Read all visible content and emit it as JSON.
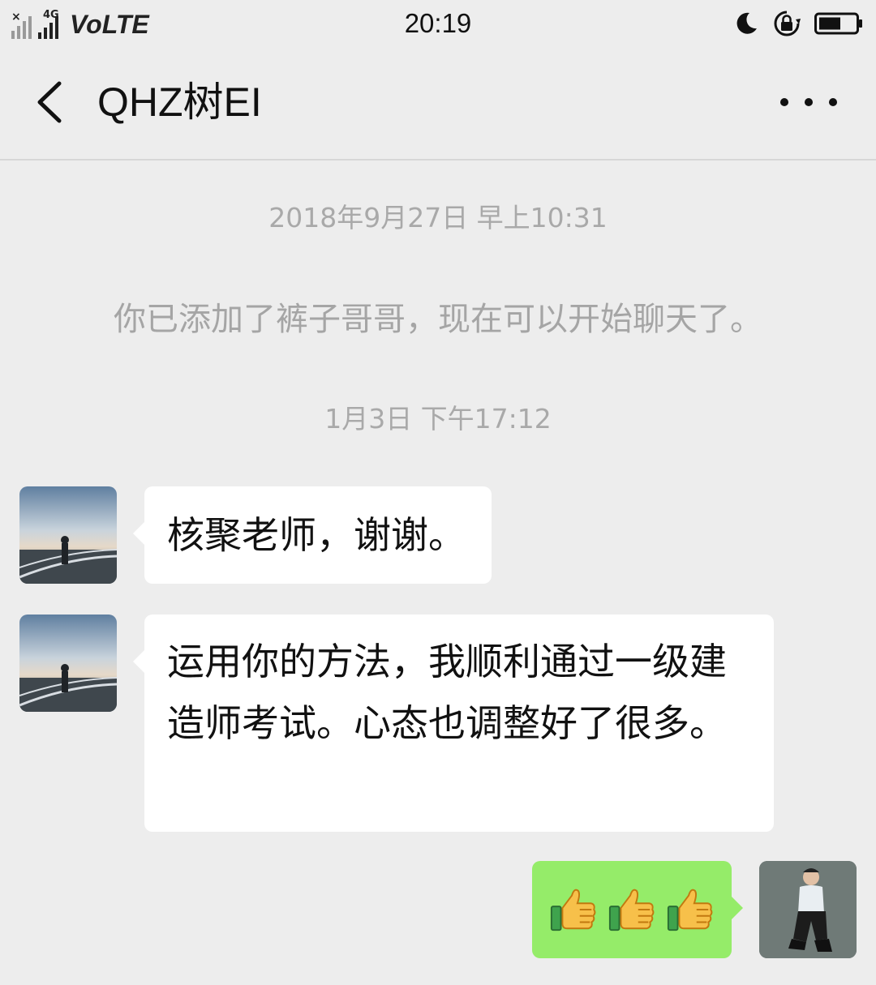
{
  "status_bar": {
    "network_label": "4G",
    "carrier_label": "VoLTE",
    "time": "20:19",
    "icons": [
      "signal-icon",
      "moon-icon",
      "rotation-lock-icon",
      "battery-icon"
    ]
  },
  "header": {
    "title": "QHZ树EI",
    "icons": [
      "back-icon",
      "more-icon"
    ]
  },
  "messages": [
    {
      "type": "timestamp",
      "text": "2018年9月27日 早上10:31"
    },
    {
      "type": "system",
      "text": "你已添加了裤子哥哥，现在可以开始聊天了。"
    },
    {
      "type": "timestamp",
      "text": "1月3日 下午17:12"
    },
    {
      "type": "incoming",
      "text": "核聚老师，谢谢。"
    },
    {
      "type": "incoming",
      "text": "运用你的方法，我顺利通过一级建造师考试。心态也调整好了很多。"
    },
    {
      "type": "outgoing",
      "content": "thumbs-up-icon x3"
    }
  ],
  "colors": {
    "background": "#ededed",
    "incoming_bubble": "#ffffff",
    "outgoing_bubble": "#95ec69",
    "system_text": "#a9a9a9"
  }
}
